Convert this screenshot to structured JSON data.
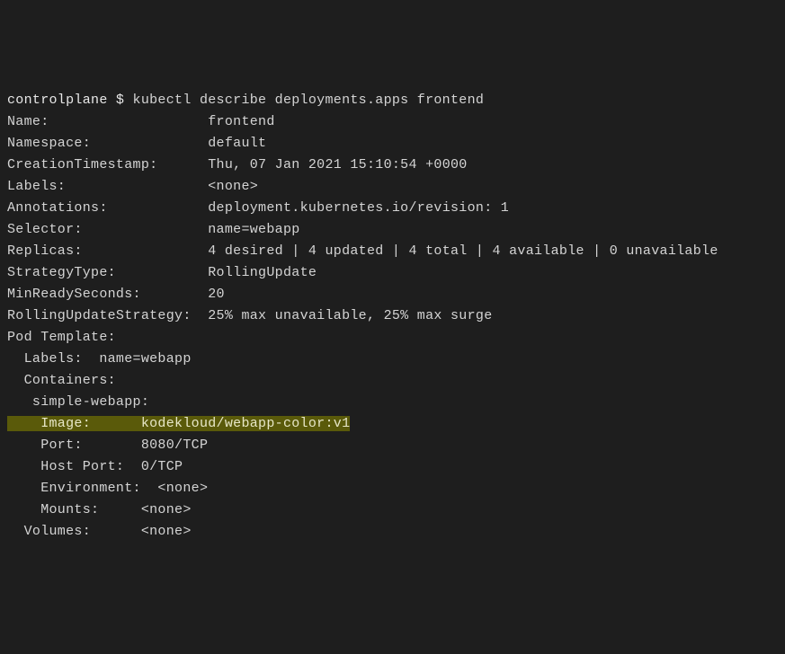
{
  "command": {
    "prompt": "controlplane $ ",
    "cmd": "kubectl describe deployments.apps frontend"
  },
  "fields": {
    "name": {
      "label": "Name:",
      "value": "frontend"
    },
    "namespace": {
      "label": "Namespace:",
      "value": "default"
    },
    "creation": {
      "label": "CreationTimestamp:",
      "value": "Thu, 07 Jan 2021 15:10:54 +0000"
    },
    "labels": {
      "label": "Labels:",
      "value": "<none>"
    },
    "annotations": {
      "label": "Annotations:",
      "value": "deployment.kubernetes.io/revision: 1"
    },
    "selector": {
      "label": "Selector:",
      "value": "name=webapp"
    },
    "replicas": {
      "label": "Replicas:",
      "value": "4 desired | 4 updated | 4 total | 4 available | 0 unavailable"
    },
    "strategy": {
      "label": "StrategyType:",
      "value": "RollingUpdate"
    },
    "minready": {
      "label": "MinReadySeconds:",
      "value": "20"
    },
    "rolling": {
      "label": "RollingUpdateStrategy:",
      "value": "25% max unavailable, 25% max surge"
    },
    "podtpl": {
      "label": "Pod Template:"
    },
    "podlabels": {
      "label": "  Labels:  name=webapp"
    },
    "containers": {
      "label": "  Containers:"
    },
    "cname": {
      "label": "   simple-webapp:"
    },
    "image": {
      "label": "    Image:      ",
      "value": "kodekloud/webapp-color:v1"
    },
    "port": {
      "label": "    Port:       ",
      "value": "8080/TCP"
    },
    "hostport": {
      "label": "    Host Port:  ",
      "value": "0/TCP"
    },
    "env": {
      "label": "    Environment:",
      "value": "  <none>"
    },
    "mounts": {
      "label": "    Mounts:     ",
      "value": "<none>"
    },
    "volumes": {
      "label": "  Volumes:      ",
      "value": "<none>"
    }
  }
}
